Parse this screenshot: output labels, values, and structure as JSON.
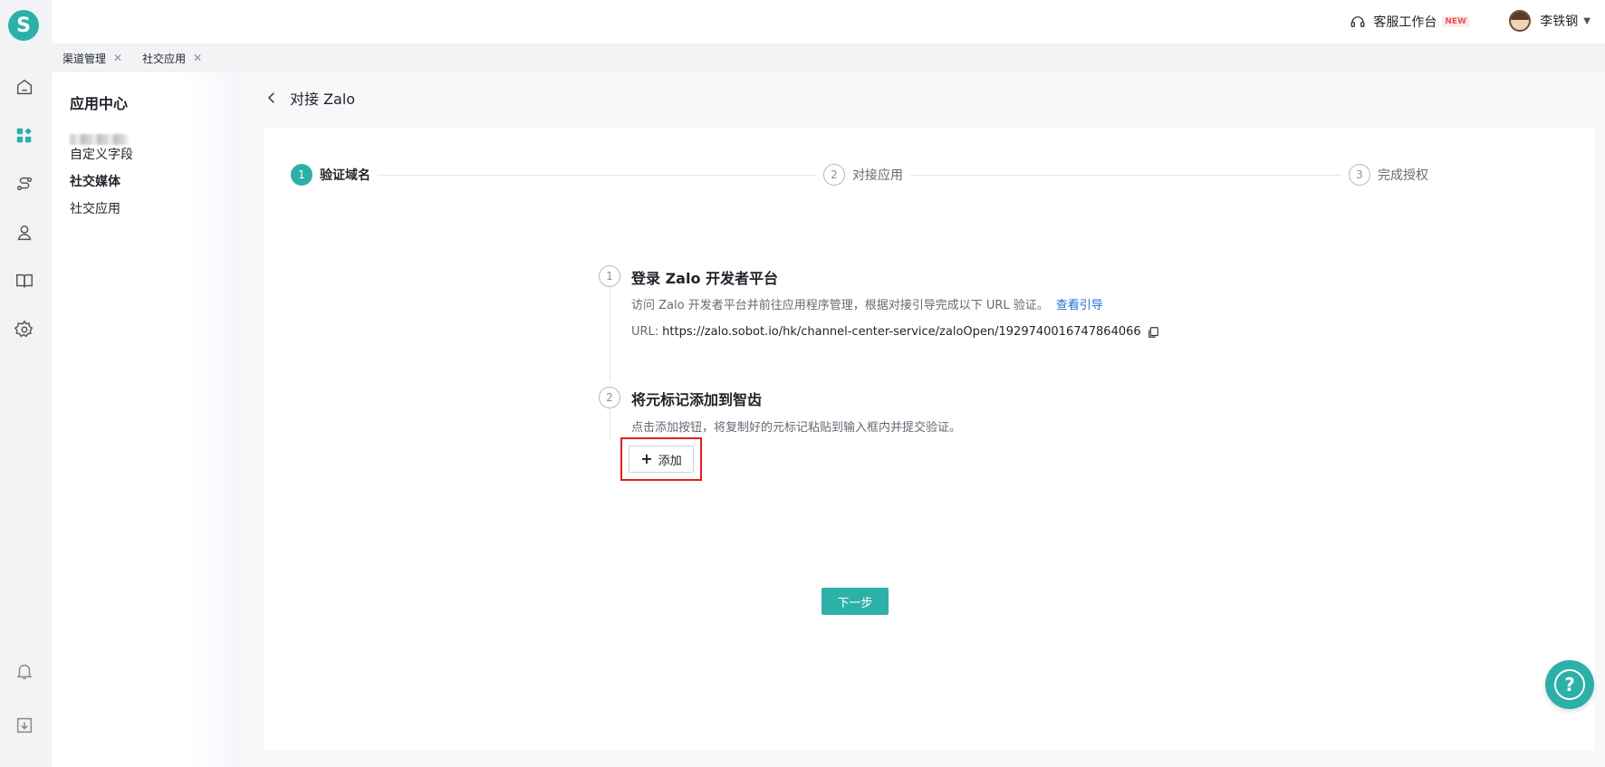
{
  "app": {
    "logo_letter": "S",
    "brand_color": "#2db0a8"
  },
  "rail": {
    "icons": [
      "home-icon",
      "apps-icon",
      "route-icon",
      "user-icon",
      "book-icon",
      "settings-icon",
      "bell-icon",
      "download-icon"
    ]
  },
  "topbar": {
    "workbench_label": "客服工作台",
    "new_badge": "NEW",
    "user_name": "李铁钢"
  },
  "tabs": [
    {
      "label": "渠道管理"
    },
    {
      "label": "社交应用"
    }
  ],
  "sidebar": {
    "title": "应用中心",
    "items": [
      {
        "label": "自定义字段"
      },
      {
        "label": "社交媒体"
      },
      {
        "label": "社交应用"
      }
    ]
  },
  "page": {
    "title": "对接 Zalo"
  },
  "steps": [
    {
      "num": "1",
      "label": "验证域名",
      "active": true
    },
    {
      "num": "2",
      "label": "对接应用",
      "active": false
    },
    {
      "num": "3",
      "label": "完成授权",
      "active": false
    }
  ],
  "block1": {
    "num": "1",
    "title": "登录 Zalo 开发者平台",
    "desc": "访问 Zalo 开发者平台并前往应用程序管理，根据对接引导完成以下 URL 验证。",
    "link": "查看引导",
    "url_label": "URL:",
    "url_value": "https://zalo.sobot.io/hk/channel-center-service/zaloOpen/1929740016747864066"
  },
  "block2": {
    "num": "2",
    "title": "将元标记添加到智齿",
    "desc": "点击添加按钮，将复制好的元标记粘贴到输入框内并提交验证。",
    "add_label": "添加"
  },
  "next_label": "下一步",
  "help_label": "?"
}
